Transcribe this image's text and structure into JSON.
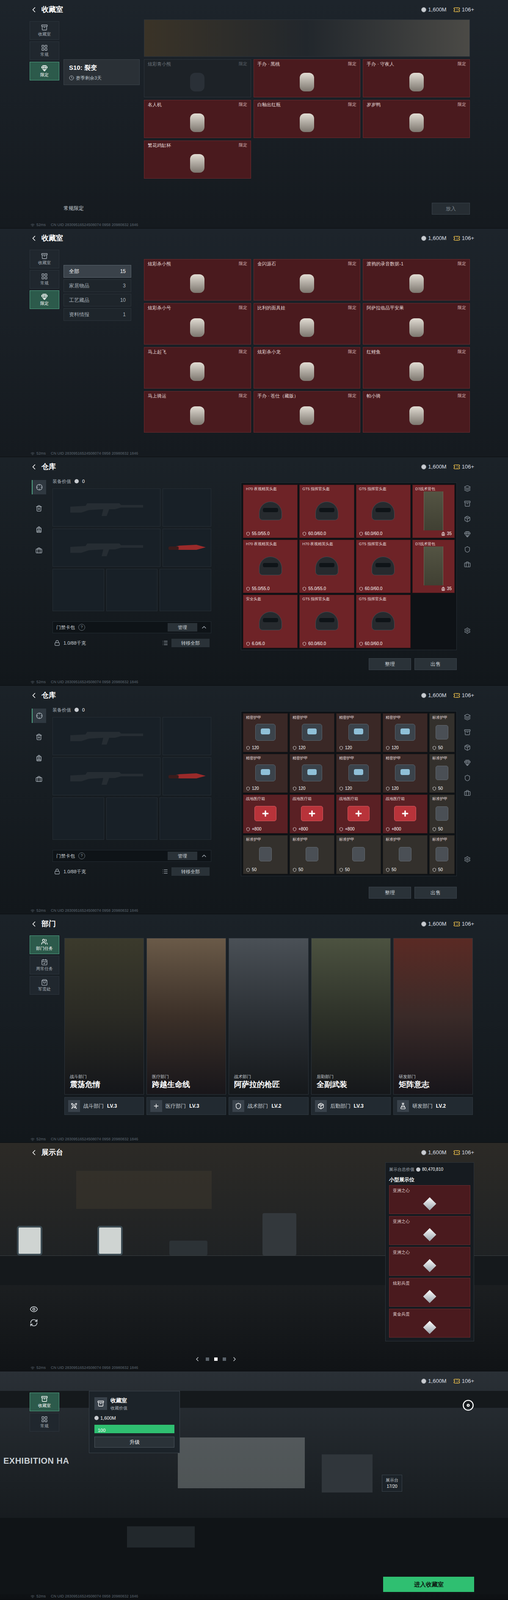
{
  "top_bar": {
    "currency": "1,600M",
    "tickets": "106+"
  },
  "status_line": {
    "ping": "52ms",
    "uid": "CN UID 28309516524508074 0958 20980832 1846"
  },
  "collection_limited": {
    "title": "收藏室",
    "sidebar": [
      {
        "label": "收藏室",
        "selected": false
      },
      {
        "label": "常规",
        "selected": false
      },
      {
        "label": "限定",
        "selected": true
      }
    ],
    "season": {
      "name": "S10: 裂变",
      "remaining": "赛季剩余3天"
    },
    "items": [
      {
        "name": "炫彩青小熊",
        "tag": "限定",
        "owned": false
      },
      {
        "name": "手办 · 黑桃",
        "tag": "限定",
        "owned": true
      },
      {
        "name": "手办 · 守夜人",
        "tag": "限定",
        "owned": true
      },
      {
        "name": "名人机",
        "tag": "限定",
        "owned": true
      },
      {
        "name": "白釉出红瓶",
        "tag": "限定",
        "owned": true
      },
      {
        "name": "岁岁鸭",
        "tag": "限定",
        "owned": true
      },
      {
        "name": "繁花鸡缸杯",
        "tag": "限定",
        "owned": true
      }
    ],
    "footer_label": "常规限定",
    "action": {
      "label": "放入",
      "disabled": true
    }
  },
  "collection_all": {
    "title": "收藏室",
    "sidebar": [
      {
        "label": "收藏室",
        "selected": false
      },
      {
        "label": "常规",
        "selected": false
      },
      {
        "label": "限定",
        "selected": true
      }
    ],
    "categories": [
      {
        "label": "全部",
        "count": "15",
        "selected": true
      },
      {
        "label": "家居物品",
        "count": "3",
        "selected": false
      },
      {
        "label": "工艺藏品",
        "count": "10",
        "selected": false
      },
      {
        "label": "资料情报",
        "count": "1",
        "selected": false
      }
    ],
    "items": [
      {
        "name": "炫彩杀小熊",
        "tag": "限定",
        "owned": true
      },
      {
        "name": "金闪源石",
        "tag": "限定",
        "owned": true
      },
      {
        "name": "渡鸦的录音数据-1",
        "tag": "限定",
        "owned": true
      },
      {
        "name": "炫彩杀小号",
        "tag": "限定",
        "owned": true
      },
      {
        "name": "比利的面具娃",
        "tag": "限定",
        "owned": true
      },
      {
        "name": "阿萨拉临品平安果",
        "tag": "限定",
        "owned": true
      },
      {
        "name": "马上起飞",
        "tag": "限定",
        "owned": true
      },
      {
        "name": "炫彩杀小龙",
        "tag": "限定",
        "owned": true
      },
      {
        "name": "红鲤鱼",
        "tag": "限定",
        "owned": true
      },
      {
        "name": "马上骑运",
        "tag": "限定",
        "owned": true
      },
      {
        "name": "手办 · 苍仕（藏版）",
        "tag": "限定",
        "owned": true
      },
      {
        "name": "帕小骑",
        "tag": "限定",
        "owned": true
      }
    ]
  },
  "warehouse_helmets": {
    "title": "仓库",
    "equipment_value_label": "装备价值",
    "equipment_value": "0",
    "card_pack": "门禁卡包",
    "help": "?",
    "manage": "管理",
    "capacity": "1.0/88千克",
    "transfer_all": "转移全部",
    "grid_buttons": [
      "整理",
      "出售"
    ],
    "items": [
      {
        "name": "H70 夜视精英头盔",
        "reading": "55.0/55.0",
        "kind": "helmet",
        "color": "#6e2327"
      },
      {
        "name": "GT5 指挥官头盔",
        "reading": "60.0/60.0",
        "kind": "helmet",
        "color": "#6e2327"
      },
      {
        "name": "GT5 指挥官头盔",
        "reading": "60.0/60.0",
        "kind": "helmet",
        "color": "#6e2327"
      },
      {
        "name": "D7战术背包",
        "reading": "35",
        "kind": "backpack",
        "color": "#6e2327"
      },
      {
        "name": "H70 夜视精英头盔",
        "reading": "55.0/55.0",
        "kind": "helmet",
        "color": "#6e2327"
      },
      {
        "name": "H70 夜视精英头盔",
        "reading": "55.0/55.0",
        "kind": "helmet",
        "color": "#6e2327"
      },
      {
        "name": "GT5 指挥官头盔",
        "reading": "60.0/60.0",
        "kind": "helmet",
        "color": "#6e2327"
      },
      {
        "name": "D7战术背包",
        "reading": "35",
        "kind": "backpack",
        "color": "#6e2327"
      },
      {
        "name": "安全头盔",
        "reading": "6.0/6.0",
        "kind": "helmet",
        "color": "#6e2327"
      },
      {
        "name": "GT5 指挥官头盔",
        "reading": "60.0/60.0",
        "kind": "helmet",
        "color": "#6e2327"
      },
      {
        "name": "GT5 指挥官头盔",
        "reading": "60.0/60.0",
        "kind": "helmet",
        "color": "#6e2327"
      }
    ]
  },
  "warehouse_armor": {
    "title": "仓库",
    "equipment_value_label": "装备价值",
    "equipment_value": "0",
    "card_pack": "门禁卡包",
    "help": "?",
    "manage": "管理",
    "capacity": "1.0/88千克",
    "transfer_all": "转移全部",
    "grid_buttons": [
      "整理",
      "出售"
    ],
    "items": [
      {
        "name": "精密护甲",
        "reading": "120",
        "kind": "armor",
        "color": "#3a2826"
      },
      {
        "name": "精密护甲",
        "reading": "120",
        "kind": "armor",
        "color": "#3a2826"
      },
      {
        "name": "精密护甲",
        "reading": "120",
        "kind": "armor",
        "color": "#3a2826"
      },
      {
        "name": "精密护甲",
        "reading": "120",
        "kind": "armor",
        "color": "#3a2826"
      },
      {
        "name": "标准护甲",
        "reading": "50",
        "kind": "vest",
        "color": "#33302c"
      },
      {
        "name": "精密护甲",
        "reading": "120",
        "kind": "armor",
        "color": "#3a2826"
      },
      {
        "name": "精密护甲",
        "reading": "120",
        "kind": "armor",
        "color": "#3a2826"
      },
      {
        "name": "精密护甲",
        "reading": "120",
        "kind": "armor",
        "color": "#3a2826"
      },
      {
        "name": "精密护甲",
        "reading": "120",
        "kind": "armor",
        "color": "#3a2826"
      },
      {
        "name": "标准护甲",
        "reading": "50",
        "kind": "vest",
        "color": "#33302c"
      },
      {
        "name": "战地医疗箱",
        "reading": "+800",
        "kind": "medkit",
        "color": "#5a2024"
      },
      {
        "name": "战地医疗箱",
        "reading": "+800",
        "kind": "medkit",
        "color": "#5a2024"
      },
      {
        "name": "战地医疗箱",
        "reading": "+800",
        "kind": "medkit",
        "color": "#5a2024"
      },
      {
        "name": "战地医疗箱",
        "reading": "+800",
        "kind": "medkit",
        "color": "#5a2024"
      },
      {
        "name": "标准护甲",
        "reading": "50",
        "kind": "vest",
        "color": "#33302c"
      },
      {
        "name": "标准护甲",
        "reading": "50",
        "kind": "vest",
        "color": "#33302c"
      },
      {
        "name": "标准护甲",
        "reading": "50",
        "kind": "vest",
        "color": "#33302c"
      },
      {
        "name": "标准护甲",
        "reading": "50",
        "kind": "vest",
        "color": "#33302c"
      },
      {
        "name": "标准护甲",
        "reading": "50",
        "kind": "vest",
        "color": "#33302c"
      },
      {
        "name": "标准护甲",
        "reading": "50",
        "kind": "vest",
        "color": "#33302c"
      }
    ]
  },
  "departments": {
    "title": "部门",
    "sidebar": [
      {
        "label": "部门任务",
        "selected": true
      },
      {
        "label": "周常任务",
        "selected": false
      },
      {
        "label": "军需处",
        "selected": false
      }
    ],
    "cards": [
      {
        "department": "战斗部门",
        "title": "震荡危情",
        "level": "LV.3"
      },
      {
        "department": "医疗部门",
        "title": "跨越生命线",
        "level": "LV.3"
      },
      {
        "department": "战术部门",
        "title": "阿萨拉的枪匠",
        "level": "LV.2"
      },
      {
        "department": "后勤部门",
        "title": "全副武装",
        "level": "LV.3"
      },
      {
        "department": "研发部门",
        "title": "矩阵意志",
        "level": "LV.2"
      }
    ]
  },
  "showcase": {
    "title": "展示台",
    "value_label": "展示台总价值",
    "value": "80,470,810",
    "section": "小型展示位",
    "slots": [
      {
        "name": "亚洲之心"
      },
      {
        "name": "亚洲之心"
      },
      {
        "name": "亚洲之心"
      },
      {
        "name": "炫彩兵蛋"
      },
      {
        "name": "黄金兵蛋"
      }
    ],
    "pages": [
      {
        "selected": false
      },
      {
        "selected": true
      },
      {
        "selected": false
      }
    ]
  },
  "hall": {
    "wall_sign": "EXHIBITION HA",
    "sidebar": [
      {
        "label": "收藏室",
        "selected": true
      },
      {
        "label": "常规",
        "selected": false
      }
    ],
    "popup": {
      "title": "收藏室",
      "subtitle": "收藏价值",
      "value": "1,600M",
      "bar": "100",
      "bar_level": 1,
      "button": "升级"
    },
    "stand": {
      "label": "展示台",
      "value": "17/20"
    },
    "enter_button": "进入收藏室"
  }
}
